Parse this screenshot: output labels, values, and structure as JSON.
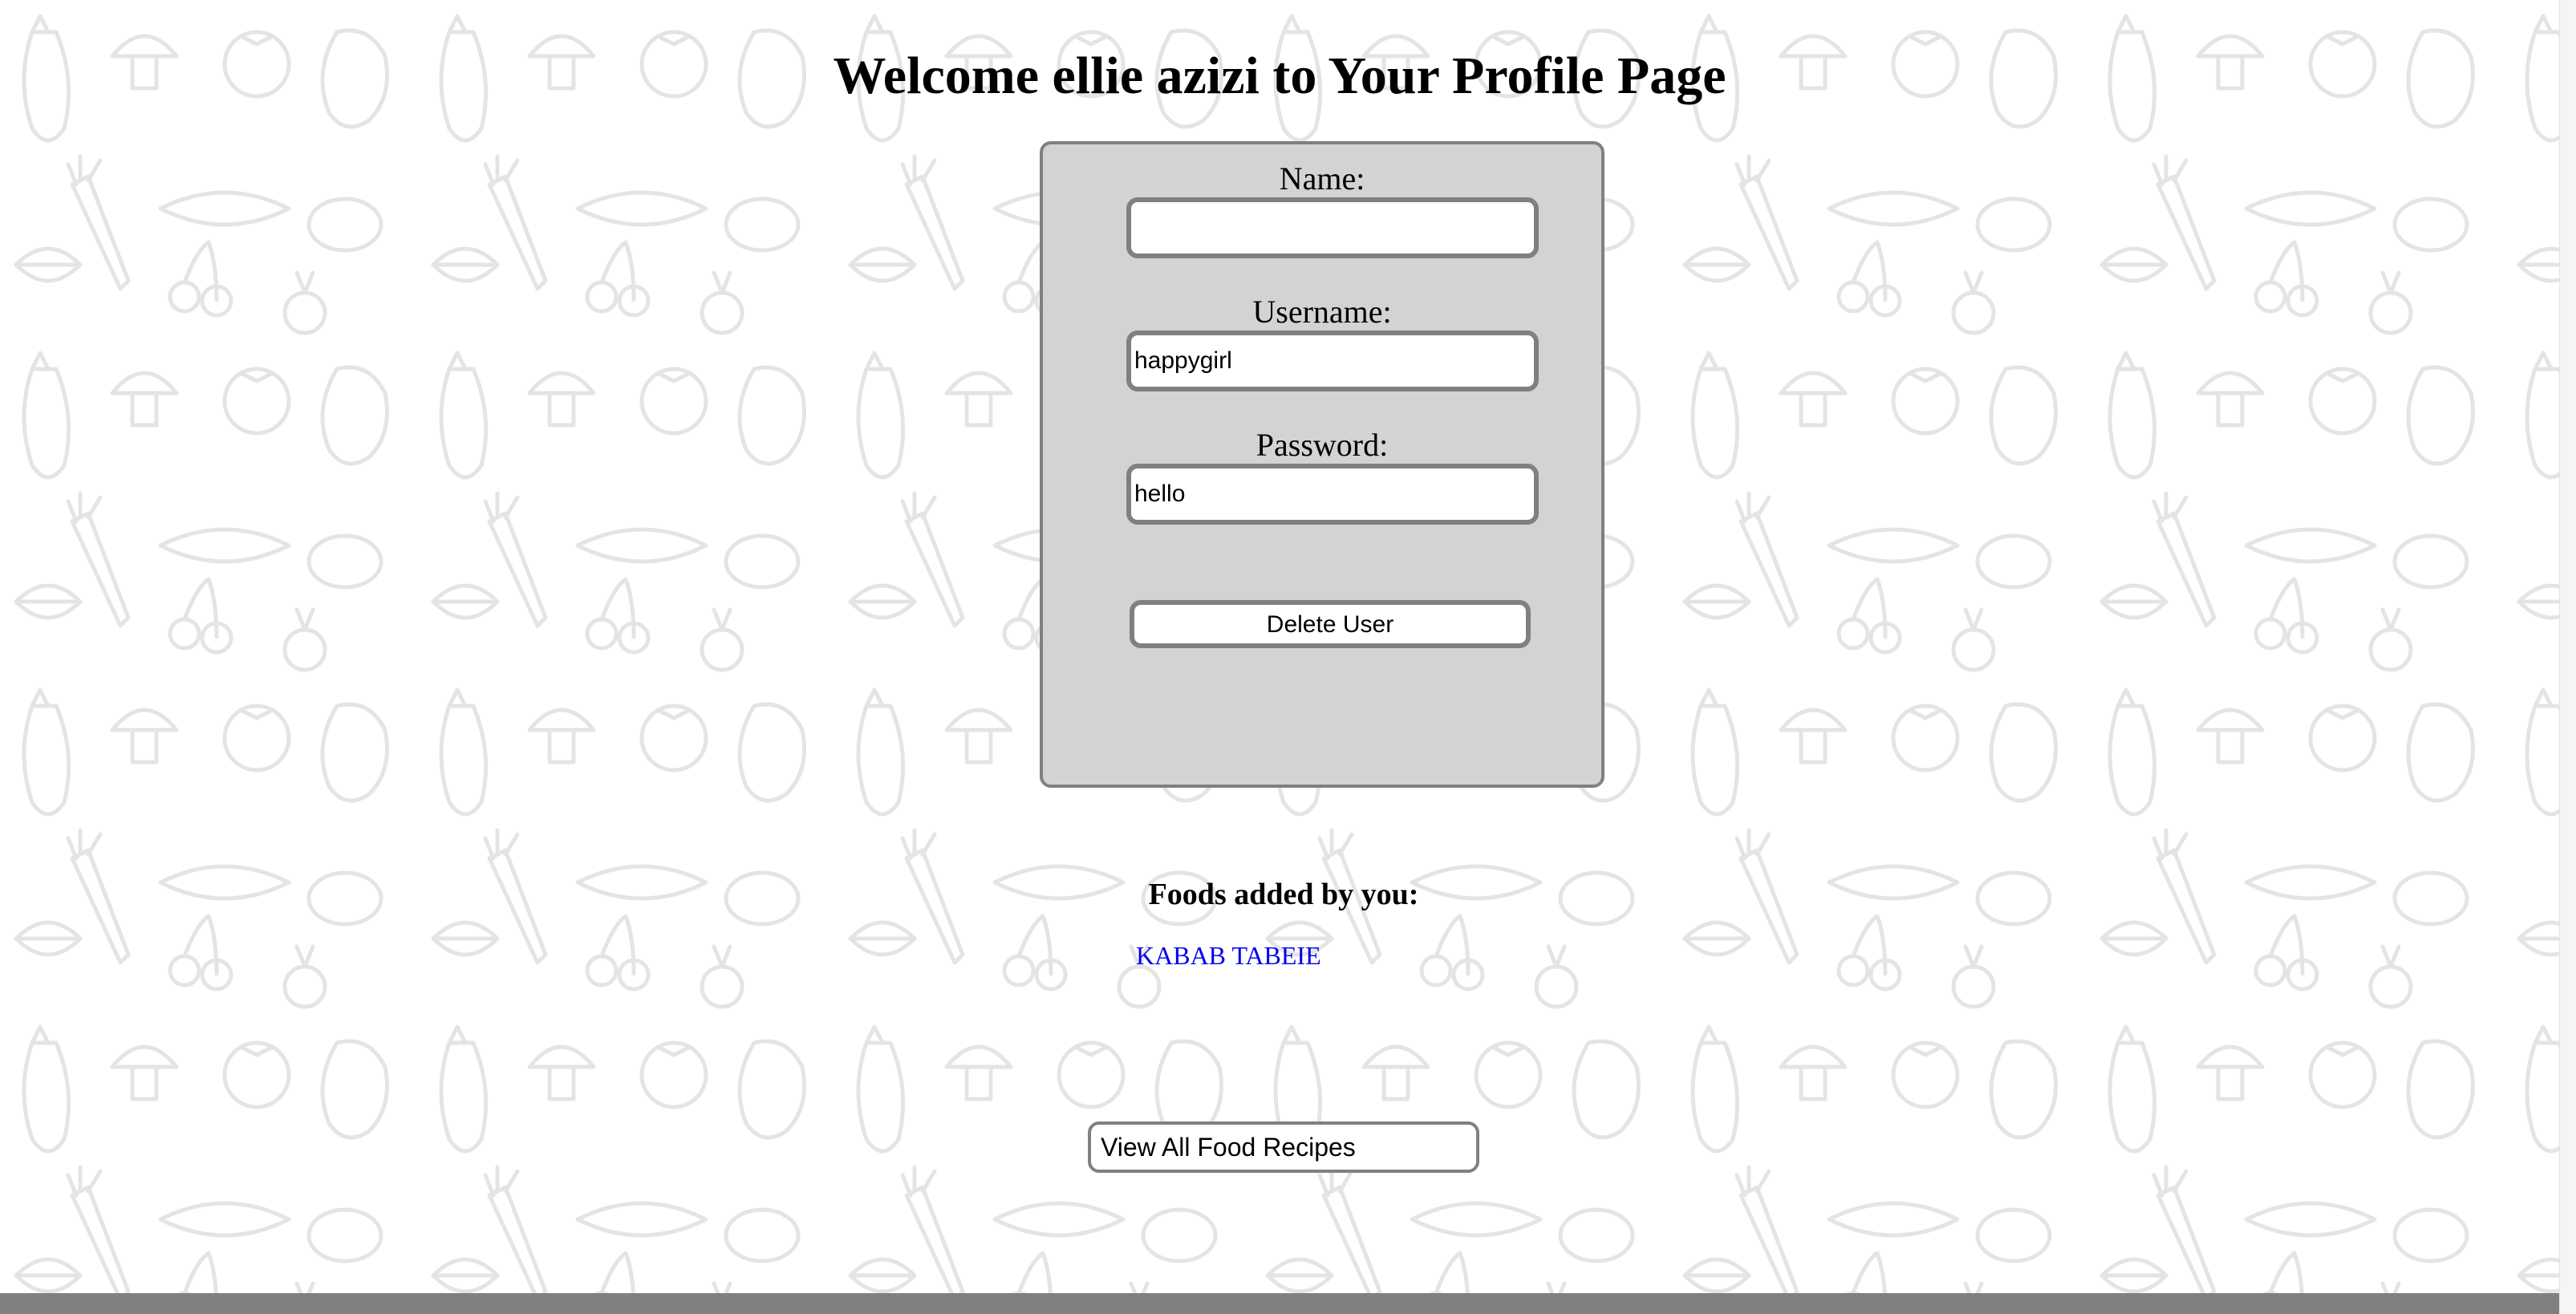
{
  "page": {
    "title": "Welcome ellie azizi to Your Profile Page"
  },
  "profile_form": {
    "name_label": "Name:",
    "name_value": "",
    "username_label": "Username:",
    "username_value": "happygirl",
    "password_label": "Password:",
    "password_value": "hello",
    "delete_button_label": "Delete User"
  },
  "foods": {
    "heading": "Foods added by you:",
    "items": [
      {
        "label": "KABAB TABEIE"
      }
    ]
  },
  "recipes_button": {
    "label": "View All Food Recipes"
  },
  "colors": {
    "card_background": "#d3d3d3",
    "border_gray": "#808080",
    "link_blue": "#0000ee",
    "doodle_stroke": "#e6e6e6"
  },
  "icons": {
    "background": "vegetable-doodle-pattern"
  }
}
